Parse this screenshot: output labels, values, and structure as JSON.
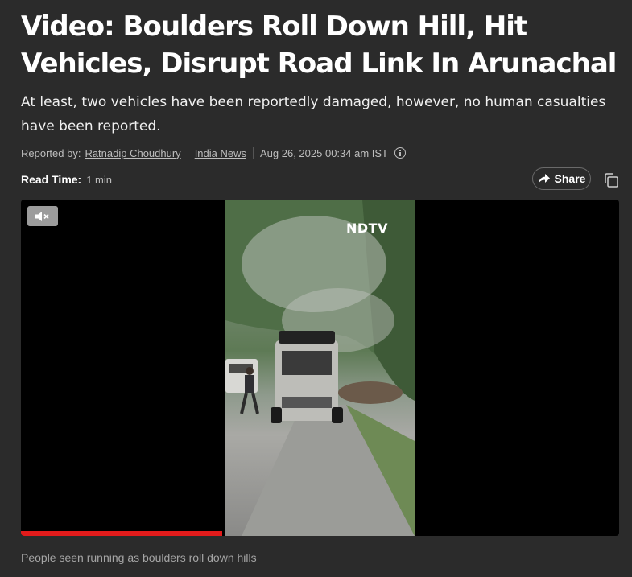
{
  "article": {
    "headline": "Video: Boulders Roll Down Hill, Hit Vehicles, Disrupt Road Link In Arunachal",
    "subheadline": "At least, two vehicles have been reportedly damaged, however, no human casualties have been reported.",
    "meta": {
      "reported_by_label": "Reported by:",
      "author": "Ratnadip Choudhury",
      "category": "India News",
      "timestamp": "Aug 26, 2025 00:34 am IST",
      "info_icon": "info-icon"
    },
    "read_time": {
      "label": "Read Time:",
      "value": "1 min"
    },
    "share": {
      "label": "Share",
      "icon": "share-arrow-icon"
    },
    "copy_icon": "copy-icon"
  },
  "video": {
    "watermark": "NDTV",
    "mute_icon": "volume-mute-icon",
    "progress": 0.336,
    "progress_color": "#e21b1b",
    "caption": "People seen running as boulders roll down hills"
  },
  "colors": {
    "background": "#2b2b2b",
    "accent": "#e21b1b"
  }
}
